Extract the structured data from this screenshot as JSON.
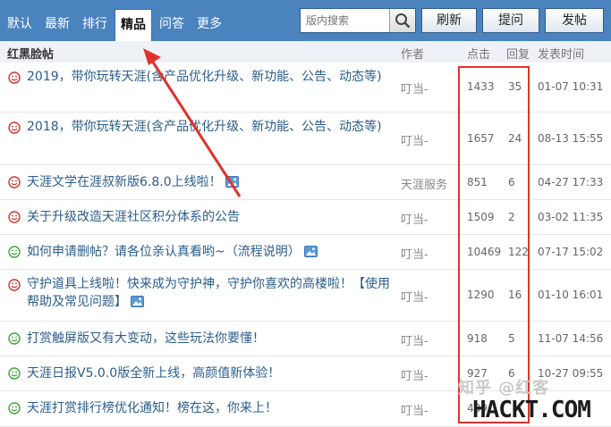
{
  "nav": {
    "tabs": [
      {
        "label": "默认"
      },
      {
        "label": "最新"
      },
      {
        "label": "排行"
      },
      {
        "label": "精品",
        "active": true
      },
      {
        "label": "问答"
      },
      {
        "label": "更多"
      }
    ],
    "search_placeholder": "版内搜索",
    "search_icon": "search-icon",
    "buttons": {
      "refresh": "刷新",
      "ask": "提问",
      "post": "发帖"
    }
  },
  "header": {
    "title": "红黑脸帖",
    "author": "作者",
    "clicks": "点击",
    "replies": "回复",
    "time": "发表时间"
  },
  "rows": [
    {
      "title": "2019，带你玩转天涯(含产品优化升级、新功能、公告、动态等)",
      "author": "叮当-",
      "clicks": "1433",
      "replies": "35",
      "time": "01-07 10:31",
      "face": "red",
      "has_image": false
    },
    {
      "title": "2018，带你玩转天涯(含产品优化升级、新功能、公告、动态等)",
      "author": "叮当-",
      "clicks": "1657",
      "replies": "24",
      "time": "08-13 15:55",
      "face": "red",
      "has_image": false
    },
    {
      "title": "天涯文学在涯叔新版6.8.0上线啦！",
      "author": "天涯服务",
      "clicks": "851",
      "replies": "6",
      "time": "04-27 17:33",
      "face": "red",
      "has_image": true
    },
    {
      "title": "关于升级改造天涯社区积分体系的公告",
      "author": "叮当-",
      "clicks": "1509",
      "replies": "2",
      "time": "03-02 11:35",
      "face": "red",
      "has_image": false
    },
    {
      "title": "如何申请删帖？请各位亲认真看哟~（流程说明）",
      "author": "叮当-",
      "clicks": "10469",
      "replies": "122",
      "time": "07-17 15:02",
      "face": "green",
      "has_image": true
    },
    {
      "title": "守护道具上线啦！快来成为守护神，守护你喜欢的高楼啦！【使用帮助及常见问题】",
      "author": "叮当-",
      "clicks": "1290",
      "replies": "16",
      "time": "01-10 16:01",
      "face": "red",
      "has_image": true
    },
    {
      "title": "打赏触屏版又有大变动，这些玩法你要懂！",
      "author": "叮当-",
      "clicks": "918",
      "replies": "5",
      "time": "11-07 14:56",
      "face": "green",
      "has_image": false
    },
    {
      "title": "天涯日报V5.0.0版全新上线，高颜值新体验！",
      "author": "叮当-",
      "clicks": "927",
      "replies": "6",
      "time": "10-27 09:55",
      "face": "green",
      "has_image": false
    },
    {
      "title": "天涯打赏排行榜优化通知！榜在这，你来上！",
      "author": "叮当-",
      "clicks": "489",
      "replies": "",
      "time": "",
      "face": "green",
      "has_image": false
    }
  ],
  "watermark": {
    "top": "知乎 @红客",
    "bottom": "HACKT.COM"
  },
  "colors": {
    "nav_bg": "#4a83bd",
    "link": "#2b5c8c",
    "annotation_red": "#e0312d",
    "face_red": "#d9302a",
    "face_green": "#3ea53a"
  }
}
